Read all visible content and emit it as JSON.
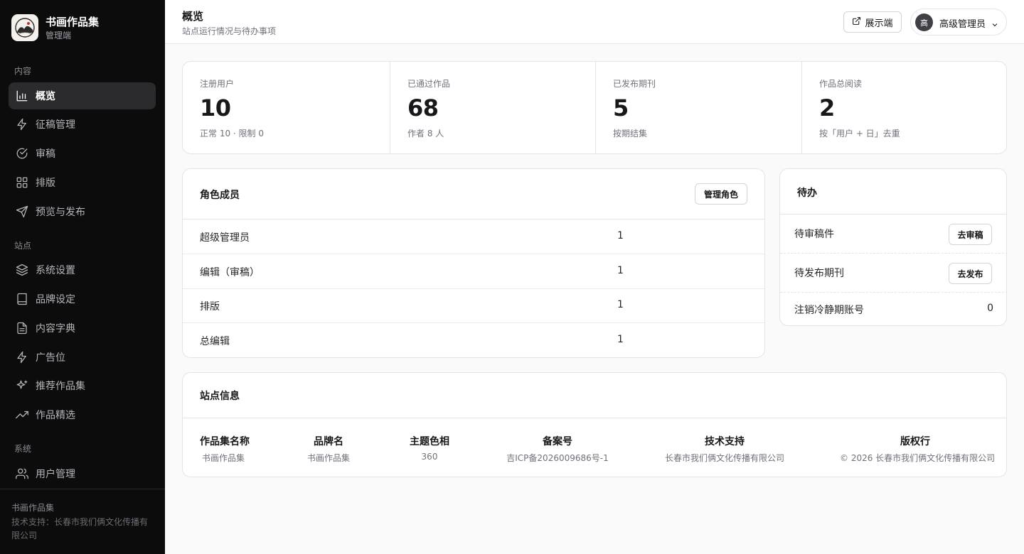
{
  "brand": {
    "title": "书画作品集",
    "subtitle": "管理端"
  },
  "nav": {
    "sections": [
      "内容",
      "站点",
      "系统"
    ],
    "items": [
      {
        "label": "概览",
        "icon": "bar-chart-icon",
        "active": true
      },
      {
        "label": "征稿管理",
        "icon": "lightning-icon"
      },
      {
        "label": "审稿",
        "icon": "check-circle-icon"
      },
      {
        "label": "排版",
        "icon": "grid-icon"
      },
      {
        "label": "预览与发布",
        "icon": "send-icon"
      },
      {
        "label": "系统设置",
        "icon": "layers-icon"
      },
      {
        "label": "品牌设定",
        "icon": "book-icon"
      },
      {
        "label": "内容字典",
        "icon": "file-text-icon"
      },
      {
        "label": "广告位",
        "icon": "lightning-icon"
      },
      {
        "label": "推荐作品集",
        "icon": "sparkles-icon"
      },
      {
        "label": "作品精选",
        "icon": "trending-up-icon"
      },
      {
        "label": "用户管理",
        "icon": "users-icon"
      }
    ]
  },
  "sidebar_footer": {
    "name": "书画作品集",
    "support": "技术支持：长春市我们俩文化传播有限公司"
  },
  "header": {
    "title": "概览",
    "subtitle": "站点运行情况与待办事项",
    "frontend_button": "展示端",
    "user": {
      "avatar_char": "高",
      "role": "高级管理员"
    }
  },
  "stats": [
    {
      "label": "注册用户",
      "value": "10",
      "note": "正常 10 · 限制 0"
    },
    {
      "label": "已通过作品",
      "value": "68",
      "note": "作者 8 人"
    },
    {
      "label": "已发布期刊",
      "value": "5",
      "note": "按期结集"
    },
    {
      "label": "作品总阅读",
      "value": "2",
      "note": "按「用户 + 日」去重"
    }
  ],
  "roles": {
    "title": "角色成员",
    "manage_button": "管理角色",
    "rows": [
      {
        "name": "超级管理员",
        "count": "1"
      },
      {
        "name": "编辑（审稿）",
        "count": "1"
      },
      {
        "name": "排版",
        "count": "1"
      },
      {
        "name": "总编辑",
        "count": "1"
      }
    ]
  },
  "todo": {
    "title": "待办",
    "items": [
      {
        "label": "待审稿件",
        "action": "去审稿"
      },
      {
        "label": "待发布期刊",
        "action": "去发布"
      },
      {
        "label": "注销冷静期账号",
        "count": "0"
      }
    ]
  },
  "site_info": {
    "title": "站点信息",
    "fields": [
      {
        "key": "作品集名称",
        "value": "书画作品集"
      },
      {
        "key": "品牌名",
        "value": "书画作品集"
      },
      {
        "key": "主题色相",
        "value": "360"
      },
      {
        "key": "备案号",
        "value": "吉ICP备2026009686号-1"
      },
      {
        "key": "技术支持",
        "value": "长春市我们俩文化传播有限公司"
      },
      {
        "key": "版权行",
        "value": "© 2026 长春市我们俩文化传播有限公司"
      }
    ]
  },
  "colors": {
    "sidebar_bg": "#0c0c0c",
    "active_nav_bg": "#2b2b2e",
    "page_bg": "#fafafa",
    "border": "#e4e4e7"
  }
}
